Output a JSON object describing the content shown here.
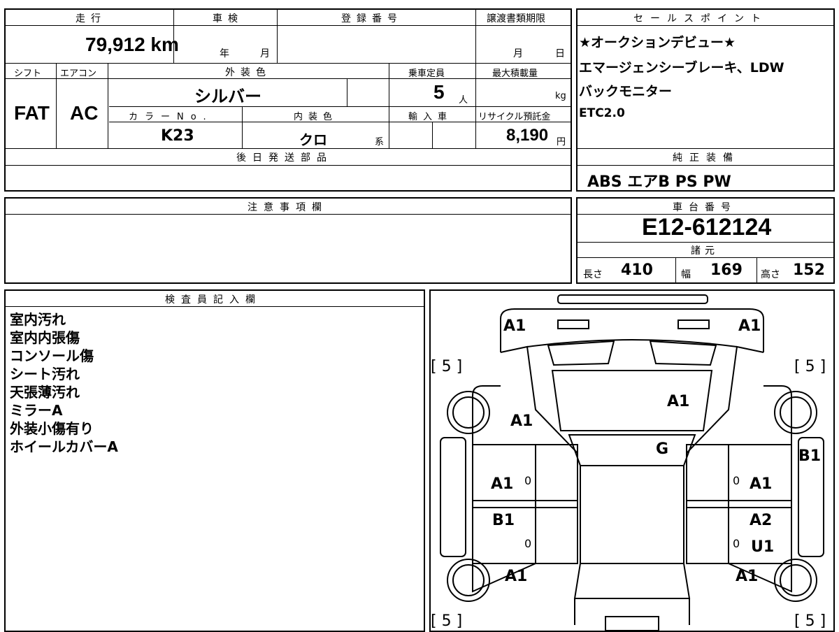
{
  "vehicle": {
    "mileage_label": "走行",
    "mileage_value": "79,912",
    "mileage_unit": "km",
    "inspection_label": "車検",
    "inspection_year_unit": "年",
    "inspection_month_unit": "月",
    "registration_label": "登録番号",
    "transfer_deadline_label": "譲渡書類期限",
    "transfer_month_unit": "月",
    "transfer_day_unit": "日",
    "shift_label": "シフト",
    "shift_value": "FAT",
    "ac_label": "エアコン",
    "ac_value": "AC",
    "exterior_color_label": "外装色",
    "exterior_color_value": "シルバー",
    "capacity_label": "乗車定員",
    "capacity_value": "5",
    "capacity_unit": "人",
    "max_load_label": "最大積載量",
    "max_load_unit": "kg",
    "color_no_label": "カラーNo.",
    "color_no_value": "K23",
    "interior_color_label": "内装色",
    "interior_color_value": "クロ",
    "interior_color_suffix": "系",
    "import_label": "輸入車",
    "recycle_label": "リサイクル預託金",
    "recycle_value": "8,190",
    "recycle_unit": "円",
    "later_parts_label": "後日発送部品"
  },
  "sales_points": {
    "title": "セールスポイント",
    "lines": [
      "★オークションデビュー★",
      "エマージェンシーブレーキ、LDW",
      "バックモニター",
      "ETC2.0"
    ]
  },
  "equipment": {
    "title": "純正装備",
    "value": "ABS エアB PS PW"
  },
  "notes": {
    "title": "注意事項欄"
  },
  "chassis": {
    "title": "車台番号",
    "value": "E12-612124",
    "specs_title": "諸元",
    "length_label": "長さ",
    "length_value": "410",
    "width_label": "幅",
    "width_value": "169",
    "height_label": "高さ",
    "height_value": "152"
  },
  "inspector": {
    "title": "検査員記入欄",
    "lines": [
      "室内汚れ",
      "室内内張傷",
      "コンソール傷",
      "シート汚れ",
      "天張薄汚れ",
      "ミラーA",
      "外装小傷有り",
      "ホイールカバーA"
    ]
  },
  "diagram_marks": {
    "front_left": "A1",
    "front_right": "A1",
    "tyre_fl": "[ 5 ]",
    "tyre_fr": "[ 5 ]",
    "tyre_rl": "[ 5 ]",
    "tyre_rr": "[ 5 ]",
    "hood": "A1",
    "left_fender": "A1",
    "windshield": "G",
    "right_side": "B1",
    "left_front_door": "A1",
    "left_rear_door": "B1",
    "right_front_door": "A1",
    "right_rear_door_1": "A2",
    "right_rear_door_2": "U1",
    "left_rear_fender": "A1",
    "right_rear_fender": "A1",
    "zero_1": "0",
    "zero_2": "0",
    "zero_3": "0",
    "zero_4": "0"
  }
}
